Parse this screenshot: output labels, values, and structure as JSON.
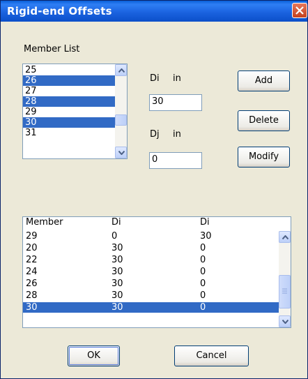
{
  "window": {
    "title": "Rigid-end Offsets"
  },
  "member_list": {
    "label": "Member List",
    "items": [
      {
        "text": "25",
        "selected": false
      },
      {
        "text": "26",
        "selected": true
      },
      {
        "text": "27",
        "selected": false
      },
      {
        "text": "28",
        "selected": true
      },
      {
        "text": "29",
        "selected": false
      },
      {
        "text": "30",
        "selected": true
      },
      {
        "text": "31",
        "selected": false
      }
    ]
  },
  "di": {
    "label": "Di",
    "unit": "in",
    "value": "30"
  },
  "dj": {
    "label": "Dj",
    "unit": "in",
    "value": "0"
  },
  "buttons": {
    "add": "Add",
    "delete": "Delete",
    "modify": "Modify",
    "ok": "OK",
    "cancel": "Cancel"
  },
  "grid": {
    "columns": [
      "Member",
      "Di",
      "Di"
    ],
    "rows": [
      {
        "member": "29",
        "di": "0",
        "dj": "30",
        "selected": false
      },
      {
        "member": "20",
        "di": "30",
        "dj": "0",
        "selected": false
      },
      {
        "member": "22",
        "di": "30",
        "dj": "0",
        "selected": false
      },
      {
        "member": "24",
        "di": "30",
        "dj": "0",
        "selected": false
      },
      {
        "member": "26",
        "di": "30",
        "dj": "0",
        "selected": false
      },
      {
        "member": "28",
        "di": "30",
        "dj": "0",
        "selected": false
      },
      {
        "member": "30",
        "di": "30",
        "dj": "0",
        "selected": true
      }
    ]
  },
  "icons": {
    "close": "close-icon",
    "scroll_up": "arrow-up-icon",
    "scroll_down": "arrow-down-icon"
  },
  "colors": {
    "title_bar": "#0b4fc9",
    "selection": "#316ac5",
    "dialog_bg": "#ece9d8"
  }
}
